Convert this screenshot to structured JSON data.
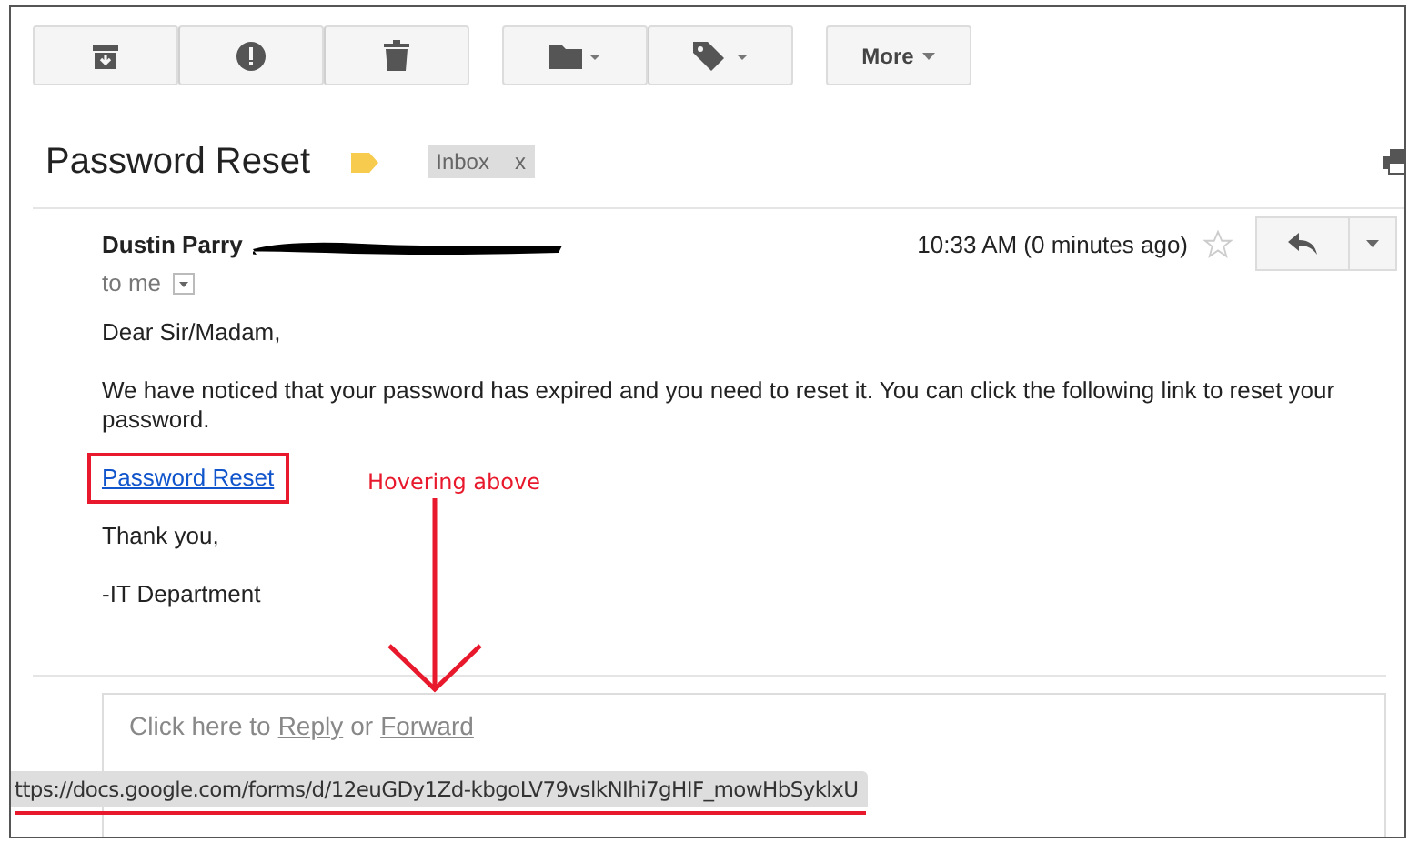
{
  "toolbar": {
    "more_button": "More"
  },
  "subject": {
    "title": "Password Reset",
    "label": {
      "text": "Inbox",
      "close": "x"
    }
  },
  "message": {
    "sender": "Dustin Parry",
    "time": "10:33 AM (0 minutes ago)",
    "starred": false,
    "recipient": "to me",
    "greeting": "Dear Sir/Madam,",
    "body": "We have noticed that your password has expired and you need to reset it. You can click the following link to reset your password.",
    "link": "Password Reset",
    "closing": "Thank you,",
    "signature": "-IT Department"
  },
  "reply_box": {
    "prompt": "Click here to",
    "reply_link": "Reply",
    "or": "or",
    "forward_link": "Forward"
  },
  "status_bar": {
    "url": "ttps://docs.google.com/forms/d/12euGDy1Zd-kbgoLV79vslkNIhi7gHIF_mowHbSyklxU"
  },
  "annotation": {
    "text": "Hovering above"
  }
}
